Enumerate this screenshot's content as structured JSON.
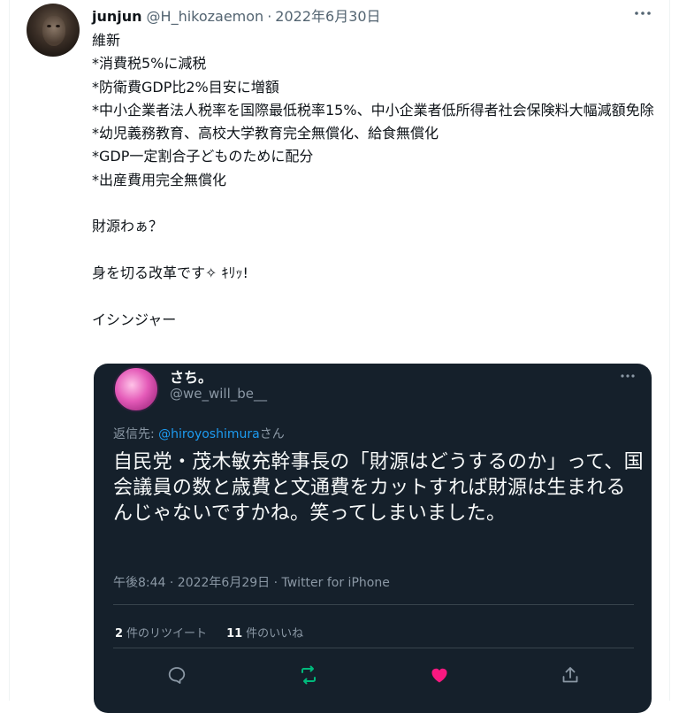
{
  "tweet": {
    "display_name": "junjun",
    "handle": "@H_hikozaemon",
    "separator": "·",
    "date": "2022年6月30日",
    "text": "維新\n*消費税5%に減税\n*防衛費GDP比2%目安に増額\n*中小企業者法人税率を国際最低税率15%、中小企業者低所得者社会保険料大幅減額免除\n*幼児義務教育、高校大学教育完全無償化、給食無償化\n*GDP一定割合子どものために配分\n*出産費用完全無償化\n\n財源わぁ？\n\n身を切る改革です✧ ｷﾘｯ!\n\nイシンジャー",
    "more_icon": "more-horizontal-icon"
  },
  "quoted": {
    "display_name": "さち。",
    "handle": "@we_will_be__",
    "reply_prefix": "返信先: ",
    "reply_to": "@hiroyoshimura",
    "reply_suffix": "さん",
    "text": "自民党・茂木敏充幹事長の「財源はどうするのか」って、国会議員の数と歳費と文通費をカットすれば財源は生まれるんじゃないですかね。笑ってしまいました。",
    "meta": "午後8:44 · 2022年6月29日 · Twitter for iPhone",
    "retweets_count": "2",
    "retweets_label": "件のリツイート",
    "likes_count": "11",
    "likes_label": "件のいいね",
    "colors": {
      "background": "#15202b",
      "retweet": "#00ba7c",
      "like": "#f91880",
      "link": "#1d9bf0"
    }
  }
}
